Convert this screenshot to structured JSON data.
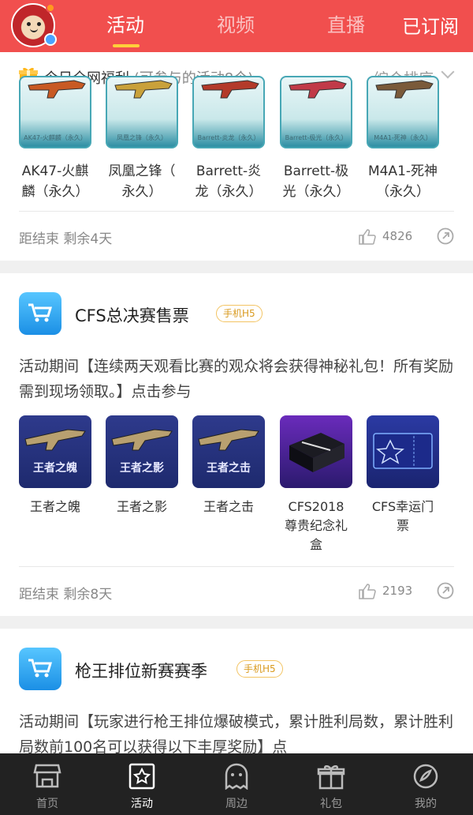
{
  "header": {
    "tabs": [
      {
        "label": "活动",
        "active": true
      },
      {
        "label": "视频",
        "active": false
      },
      {
        "label": "直播",
        "active": false
      }
    ],
    "subscribed_label": "已订阅",
    "accent_color": "#f14f4e"
  },
  "filter": {
    "title": "今日全网福利",
    "count_text": "(可参与的活动8个)",
    "sort_label": "综合排序"
  },
  "card1": {
    "items": [
      {
        "thumb_label": "AK47-火麒麟（永久）",
        "name": "AK47-火麒\n麟（永久）"
      },
      {
        "thumb_label": "凤凰之锋（永久）",
        "name": "凤凰之锋（\n永久）"
      },
      {
        "thumb_label": "Barrett-炎龙（永久）",
        "name": "Barrett-炎\n龙（永久）"
      },
      {
        "thumb_label": "Barrett-极光（永久）",
        "name": "Barrett-极\n光（永久）"
      },
      {
        "thumb_label": "M4A1-死神（永久）",
        "name": "M4A1-死神\n（永久）"
      }
    ],
    "remain": "距结束 剩余4天",
    "likes": "4826"
  },
  "card2": {
    "title": "CFS总决赛售票",
    "tag": "手机H5",
    "desc": "活动期间【连续两天观看比赛的观众将会获得神秘礼包！所有奖励需到现场领取。】点击参与",
    "items": [
      {
        "thumb_text": "王者之魄",
        "name": "王者之魄"
      },
      {
        "thumb_text": "王者之影",
        "name": "王者之影"
      },
      {
        "thumb_text": "王者之击",
        "name": "王者之击"
      },
      {
        "thumb_text": "",
        "name": "CFS2018\n尊贵纪念礼\n盒"
      },
      {
        "thumb_text": "",
        "name": "CFS幸运门\n票"
      }
    ],
    "remain": "距结束 剩余8天",
    "likes": "2193"
  },
  "card3": {
    "title": "枪王排位新赛赛季",
    "tag": "手机H5",
    "desc": "活动期间【玩家进行枪王排位爆破模式，累计胜利局数，累计胜利局数前100名可以获得以下丰厚奖励】点"
  },
  "bottom_nav": [
    {
      "label": "首页",
      "icon": "store-icon",
      "active": false
    },
    {
      "label": "活动",
      "icon": "star-frame-icon",
      "active": true
    },
    {
      "label": "周边",
      "icon": "ghost-icon",
      "active": false
    },
    {
      "label": "礼包",
      "icon": "gift-box-icon",
      "active": false
    },
    {
      "label": "我的",
      "icon": "compass-icon",
      "active": false
    }
  ]
}
